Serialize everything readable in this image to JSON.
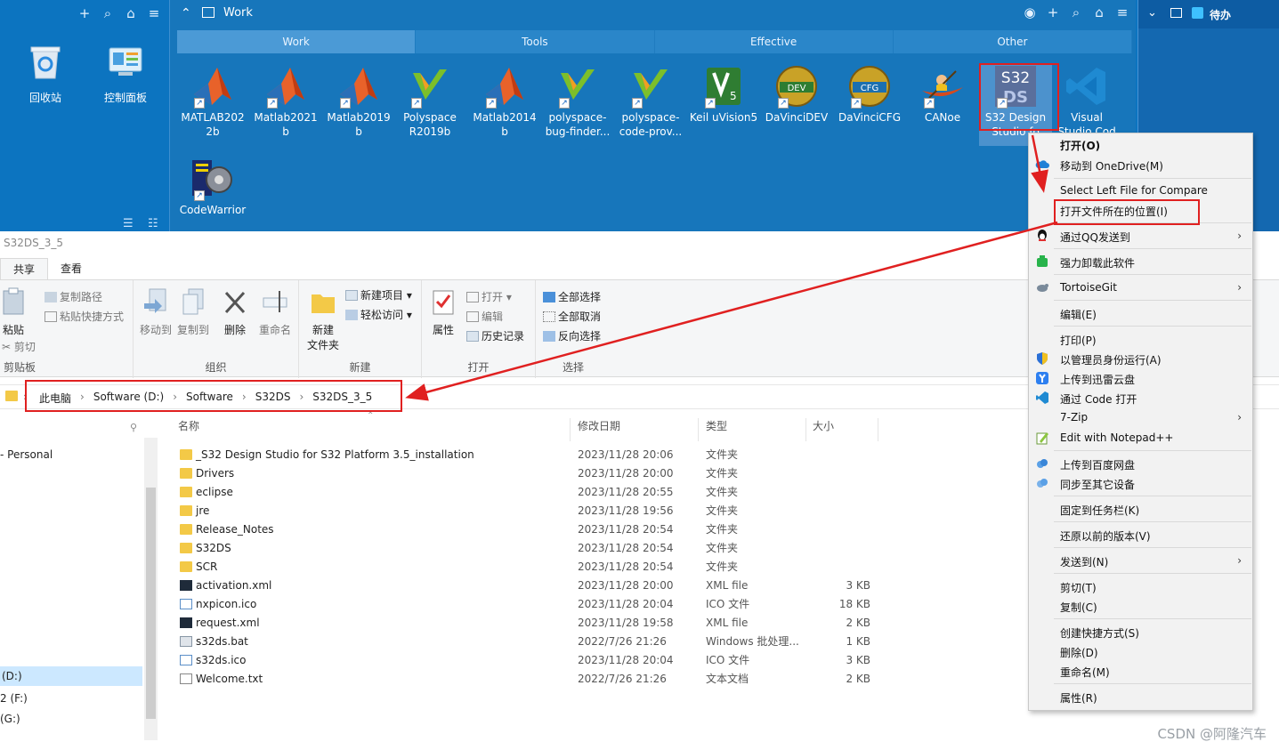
{
  "desktop": {
    "left_icons": [
      {
        "label": "回收站"
      },
      {
        "label": "控制面板"
      }
    ],
    "work_fence": {
      "title": "Work",
      "tabs": [
        "Work",
        "Tools",
        "Effective",
        "Other"
      ],
      "apps": [
        {
          "label1": "MATLAB202",
          "label2": "2b"
        },
        {
          "label1": "Matlab2021",
          "label2": "b"
        },
        {
          "label1": "Matlab2019",
          "label2": "b"
        },
        {
          "label1": "Polyspace",
          "label2": "R2019b"
        },
        {
          "label1": "Matlab2014",
          "label2": "b"
        },
        {
          "label1": "polyspace-",
          "label2": "bug-finder..."
        },
        {
          "label1": "polyspace-",
          "label2": "code-prov..."
        },
        {
          "label1": "Keil uVision5",
          "label2": ""
        },
        {
          "label1": "DaVinciDEV",
          "label2": ""
        },
        {
          "label1": "DaVinciCFG",
          "label2": ""
        },
        {
          "label1": "CANoe",
          "label2": ""
        },
        {
          "label1": "S32 Design",
          "label2": "Studio fo"
        },
        {
          "label1": "Visual",
          "label2": "Studio Cod"
        },
        {
          "label1": "CodeWarrior",
          "label2": ""
        }
      ],
      "app_icon_texts": {
        "s32_top": "S32",
        "s32_bottom": "DS",
        "dev": "DEV",
        "cfg": "CFG"
      }
    },
    "right_fence": {
      "title": "待办"
    }
  },
  "explorer": {
    "window_title": "S32DS_3_5",
    "ribbon_tabs": [
      "共享",
      "查看"
    ],
    "groups": {
      "clipboard": {
        "name": "剪贴板",
        "paste": "粘贴",
        "copy_path": "复制路径",
        "paste_shortcut": "粘贴快捷方式",
        "cut": "剪切"
      },
      "organize": {
        "name": "组织",
        "move_to": "移动到",
        "copy_to": "复制到",
        "delete": "删除",
        "rename": "重命名"
      },
      "new": {
        "name": "新建",
        "new_folder_1": "新建",
        "new_folder_2": "文件夹",
        "new_item": "新建项目",
        "easy_access": "轻松访问"
      },
      "open": {
        "name": "打开",
        "properties": "属性",
        "open": "打开",
        "edit": "编辑",
        "history": "历史记录"
      },
      "select": {
        "name": "选择",
        "select_all": "全部选择",
        "select_none": "全部取消",
        "invert": "反向选择"
      }
    },
    "breadcrumb": [
      "此电脑",
      "Software (D:)",
      "Software",
      "S32DS",
      "S32DS_3_5"
    ],
    "nav_items": [
      "- Personal",
      "(D:)",
      "2 (F:)",
      "(G:)"
    ],
    "columns": {
      "name": "名称",
      "date": "修改日期",
      "type": "类型",
      "size": "大小"
    },
    "files": [
      {
        "name": "_S32 Design Studio for S32 Platform 3.5_installation",
        "date": "2023/11/28 20:06",
        "type": "文件夹",
        "size": "",
        "kind": "folder"
      },
      {
        "name": "Drivers",
        "date": "2023/11/28 20:00",
        "type": "文件夹",
        "size": "",
        "kind": "folder"
      },
      {
        "name": "eclipse",
        "date": "2023/11/28 20:55",
        "type": "文件夹",
        "size": "",
        "kind": "folder"
      },
      {
        "name": "jre",
        "date": "2023/11/28 19:56",
        "type": "文件夹",
        "size": "",
        "kind": "folder"
      },
      {
        "name": "Release_Notes",
        "date": "2023/11/28 20:54",
        "type": "文件夹",
        "size": "",
        "kind": "folder"
      },
      {
        "name": "S32DS",
        "date": "2023/11/28 20:54",
        "type": "文件夹",
        "size": "",
        "kind": "folder"
      },
      {
        "name": "SCR",
        "date": "2023/11/28 20:54",
        "type": "文件夹",
        "size": "",
        "kind": "folder"
      },
      {
        "name": "activation.xml",
        "date": "2023/11/28 20:00",
        "type": "XML file",
        "size": "3 KB",
        "kind": "xml"
      },
      {
        "name": "nxpicon.ico",
        "date": "2023/11/28 20:04",
        "type": "ICO 文件",
        "size": "18 KB",
        "kind": "ico"
      },
      {
        "name": "request.xml",
        "date": "2023/11/28 19:58",
        "type": "XML file",
        "size": "2 KB",
        "kind": "xml"
      },
      {
        "name": "s32ds.bat",
        "date": "2022/7/26 21:26",
        "type": "Windows 批处理...",
        "size": "1 KB",
        "kind": "bat"
      },
      {
        "name": "s32ds.ico",
        "date": "2023/11/28 20:04",
        "type": "ICO 文件",
        "size": "3 KB",
        "kind": "ico"
      },
      {
        "name": "Welcome.txt",
        "date": "2022/7/26 21:26",
        "type": "文本文档",
        "size": "2 KB",
        "kind": "txt"
      }
    ]
  },
  "context_menu": {
    "items": [
      {
        "label": "打开(O)",
        "bold": true
      },
      {
        "label": "移动到 OneDrive(M)",
        "icon": "onedrive-icon"
      },
      {
        "label": "Select Left File for Compare"
      },
      {
        "label": "打开文件所在的位置(I)"
      },
      {
        "label": "通过QQ发送到",
        "icon": "qq-icon",
        "submenu": true
      },
      {
        "label": "强力卸载此软件",
        "icon": "uninstall-icon"
      },
      {
        "label": "TortoiseGit",
        "icon": "tortoisegit-icon",
        "submenu": true
      },
      {
        "label": "编辑(E)"
      },
      {
        "label": "打印(P)"
      },
      {
        "label": "以管理员身份运行(A)",
        "icon": "shield-icon"
      },
      {
        "label": "上传到迅雷云盘",
        "icon": "thunder-icon"
      },
      {
        "label": "通过 Code 打开",
        "icon": "vscode-icon"
      },
      {
        "label": "7-Zip",
        "submenu": true
      },
      {
        "label": "Edit with Notepad++",
        "icon": "notepadpp-icon"
      },
      {
        "label": "上传到百度网盘",
        "icon": "baidu-icon"
      },
      {
        "label": "同步至其它设备",
        "icon": "baidu-sync-icon"
      },
      {
        "label": "固定到任务栏(K)"
      },
      {
        "label": "还原以前的版本(V)"
      },
      {
        "label": "发送到(N)",
        "submenu": true
      },
      {
        "label": "剪切(T)"
      },
      {
        "label": "复制(C)"
      },
      {
        "label": "创建快捷方式(S)"
      },
      {
        "label": "删除(D)"
      },
      {
        "label": "重命名(M)"
      },
      {
        "label": "属性(R)"
      }
    ]
  },
  "watermark": "CSDN @阿隆汽车",
  "colors": {
    "desktop_blue": "#0c74c0",
    "highlight_red": "#e02020",
    "selected_nav": "#cce8ff"
  }
}
